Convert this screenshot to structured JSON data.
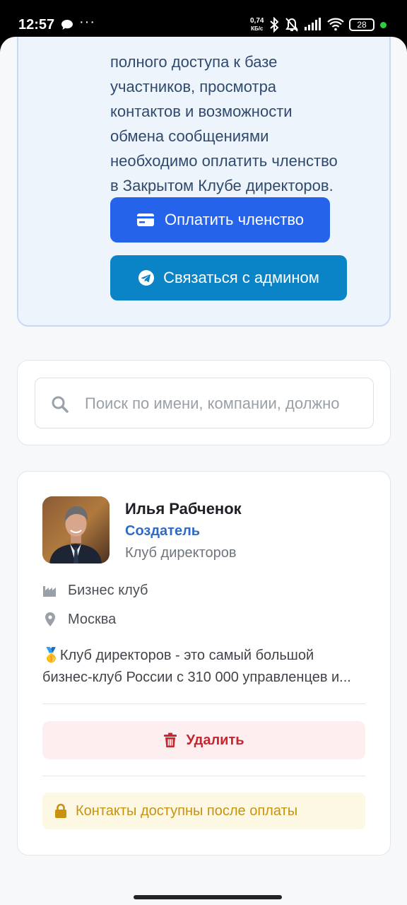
{
  "status_bar": {
    "time": "12:57",
    "speed_value": "0,74",
    "speed_unit": "КБ/с",
    "battery": "28",
    "icons": [
      "message-icon",
      "more-dots-icon",
      "bluetooth-icon",
      "mute-icon",
      "signal-icon",
      "wifi-icon",
      "battery-icon"
    ]
  },
  "paywall": {
    "line1": "полного доступа к базе",
    "line2": "участников, просмотра",
    "line3": "контактов и возможности",
    "line4": "обмена сообщениями",
    "line5": "необходимо оплатить членство",
    "line6": "в Закрытом Клубе директоров.",
    "pay_button": "Оплатить членство",
    "admin_button": "Связаться с админом",
    "colors": {
      "pay": "#2563eb",
      "admin": "#0a84c6"
    }
  },
  "search": {
    "placeholder": "Поиск по имени, компании, должно"
  },
  "member": {
    "name": "Илья Рабченок",
    "role": "Создатель",
    "organization": "Клуб директоров",
    "industry": "Бизнес клуб",
    "city": "Москва",
    "description_line1": "🥇Клуб директоров - это самый большой",
    "description_line2": "бизнес-клуб России с 310 000 управленцев и...",
    "delete_button": "Удалить",
    "contacts_locked": "Контакты доступны после оплаты",
    "colors": {
      "role": "#2f6bc4",
      "delete": "#c8262f",
      "locked": "#c9920c"
    }
  }
}
